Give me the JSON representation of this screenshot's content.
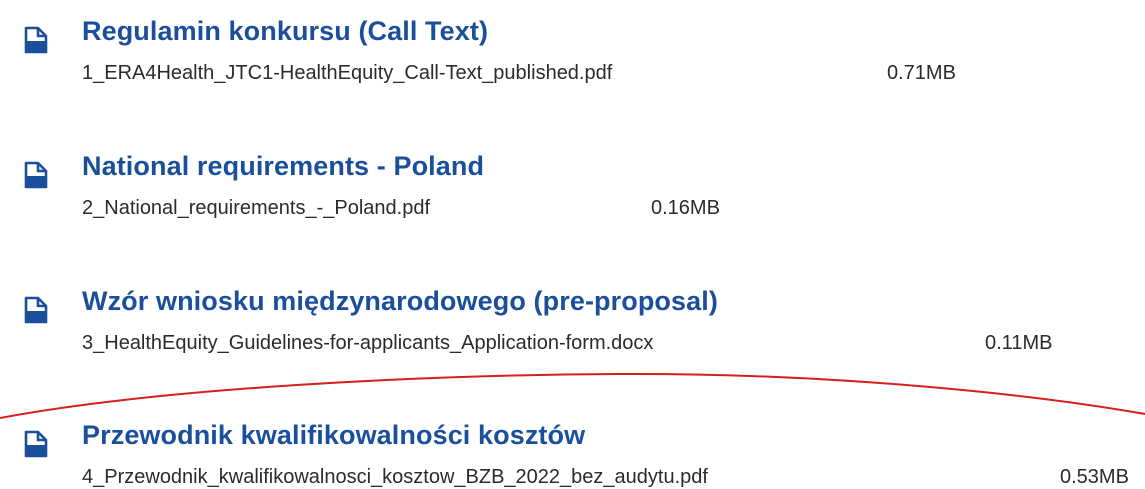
{
  "colors": {
    "title": "#1a4f9c",
    "text": "#2b2b2b",
    "icon": "#1a4f9c",
    "annotation": "#d42020"
  },
  "documents": [
    {
      "icon": "file-document-icon",
      "title": "Regulamin konkursu (Call Text)",
      "filename": "1_ERA4Health_JTC1-HealthEquity_Call-Text_published.pdf",
      "size": "0.71MB"
    },
    {
      "icon": "file-document-icon",
      "title": "National requirements - Poland",
      "filename": "2_National_requirements_-_Poland.pdf",
      "size": "0.16MB"
    },
    {
      "icon": "file-document-icon",
      "title": "Wzór wniosku międzynarodowego (pre-proposal)",
      "filename": "3_HealthEquity_Guidelines-for-applicants_Application-form.docx",
      "size": "0.11MB"
    },
    {
      "icon": "file-document-icon",
      "title": "Przewodnik kwalifikowalności kosztów",
      "filename": "4_Przewodnik_kwalifikowalnosci_kosztow_BZB_2022_bez_audytu.pdf",
      "size": "0.53MB"
    }
  ]
}
